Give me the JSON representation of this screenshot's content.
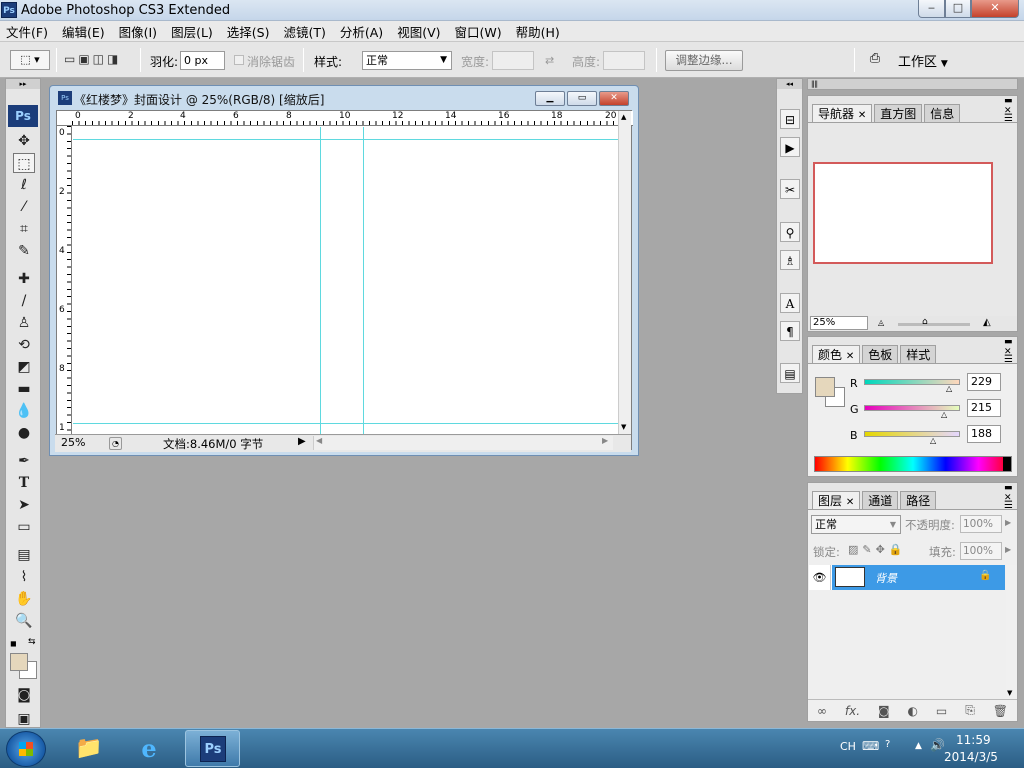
{
  "window": {
    "title": "Adobe Photoshop CS3 Extended",
    "icon_text": "Ps",
    "min": "‒",
    "max": "□",
    "close": "✕"
  },
  "menu": [
    "文件(F)",
    "编辑(E)",
    "图像(I)",
    "图层(L)",
    "选择(S)",
    "滤镜(T)",
    "分析(A)",
    "视图(V)",
    "窗口(W)",
    "帮助(H)"
  ],
  "options": {
    "feather_label": "羽化:",
    "feather_value": "0 px",
    "antialias_label": "消除锯齿",
    "style_label": "样式:",
    "style_value": "正常",
    "width_label": "宽度:",
    "height_label": "高度:",
    "refine_label": "调整边缘...",
    "workspace_label": "工作区"
  },
  "toolbox": {
    "logo": "Ps"
  },
  "document": {
    "title": "《红楼梦》封面设计 @ 25%(RGB/8) [缩放后]",
    "zoom": "25%",
    "status": "文档:8.46M/0 字节",
    "h_ruler": [
      "0",
      "2",
      "4",
      "6",
      "8",
      "10",
      "12",
      "14",
      "16",
      "18",
      "20"
    ],
    "v_ruler": [
      "0",
      "2",
      "4",
      "6",
      "8",
      "1"
    ]
  },
  "navigator": {
    "tabs": [
      "导航器",
      "直方图",
      "信息"
    ],
    "zoom": "25%"
  },
  "color": {
    "tabs": [
      "颜色",
      "色板",
      "样式"
    ],
    "channels": [
      {
        "label": "R",
        "value": "229"
      },
      {
        "label": "G",
        "value": "215"
      },
      {
        "label": "B",
        "value": "188"
      }
    ],
    "foreground": "#e5d7bc"
  },
  "layers": {
    "tabs": [
      "图层",
      "通道",
      "路径"
    ],
    "blend": "正常",
    "opacity_label": "不透明度:",
    "opacity": "100%",
    "lock_label": "锁定:",
    "fill_label": "填充:",
    "fill": "100%",
    "items": [
      {
        "name": "背景"
      }
    ]
  },
  "taskbar": {
    "lang": "CH",
    "time": "11:59",
    "date": "2014/3/5"
  }
}
